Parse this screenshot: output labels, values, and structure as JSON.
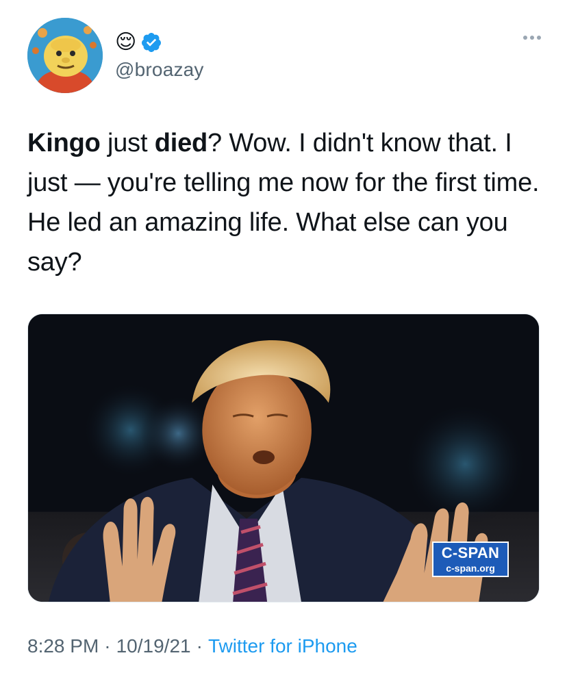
{
  "author": {
    "emoji": "😌",
    "handle": "@broazay",
    "verified": true,
    "avatar_icon": "cartoon-avatar",
    "more_icon": "more-options-icon"
  },
  "tweet": {
    "segments": [
      {
        "text": "Kingo",
        "bold": true
      },
      {
        "text": " just ",
        "bold": false
      },
      {
        "text": "died",
        "bold": true
      },
      {
        "text": "? Wow. I didn't know that. I just — you're telling me now for the first time. He led an amazing life. What else can you say?",
        "bold": false
      }
    ]
  },
  "media": {
    "watermark_brand": "C-SPAN",
    "watermark_site": "c-span.org"
  },
  "meta": {
    "time": "8:28 PM",
    "separator": "·",
    "date": "10/19/21",
    "source": "Twitter for iPhone"
  },
  "colors": {
    "link": "#1d9bf0",
    "muted": "#536471",
    "verified_badge": "#1d9bf0",
    "cspan_blue": "#1d5bb8"
  }
}
